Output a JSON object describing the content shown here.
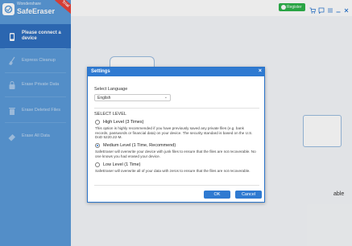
{
  "app": {
    "brand_line1": "Wondershare",
    "brand_line2": "SafeEraser",
    "trial_label": "Trial"
  },
  "sidebar": {
    "items": [
      {
        "label": "Please connect a device",
        "icon": "phone-icon",
        "active": true
      },
      {
        "label": "Express Cleanup",
        "icon": "broom-icon",
        "active": false
      },
      {
        "label": "Erase Private Data",
        "icon": "lock-icon",
        "active": false
      },
      {
        "label": "Erase Deleted Files",
        "icon": "trash-icon",
        "active": false
      },
      {
        "label": "Erase All Data",
        "icon": "eraser-icon",
        "active": false
      }
    ]
  },
  "topbar": {
    "register_label": "Register"
  },
  "background": {
    "partial_text": "able"
  },
  "dialog": {
    "title": "Settings",
    "close_glyph": "×",
    "language_label": "Select Language",
    "language_value": "English",
    "level_label": "SELECT LEVEL",
    "options": [
      {
        "title": "High Level  (3 Times)",
        "desc": "This option is highly recommended if you have previously saved any private files (e.g. bank records, passwords or financial data) on your device. The security standard is based on the U.S. DoD 5220.22-M.",
        "checked": false
      },
      {
        "title": "Medium Level  (1 Time, Recommend)",
        "desc": "SafeEraser will overwrite your device with junk files to ensure that the files are not recoverable. No one knows you had erased your device.",
        "checked": true
      },
      {
        "title": "Low Level  (1 Time)",
        "desc": "SafeEraser will overwrite all of your data with zeros to ensure that the files are not recoverable.",
        "checked": false
      }
    ],
    "ok_label": "OK",
    "cancel_label": "Cancel"
  },
  "colors": {
    "sidebar": "#5b9bd9",
    "sidebar_active": "#2f6fbf",
    "dialog_titlebar": "#2f7ad1",
    "register": "#2db24a"
  }
}
